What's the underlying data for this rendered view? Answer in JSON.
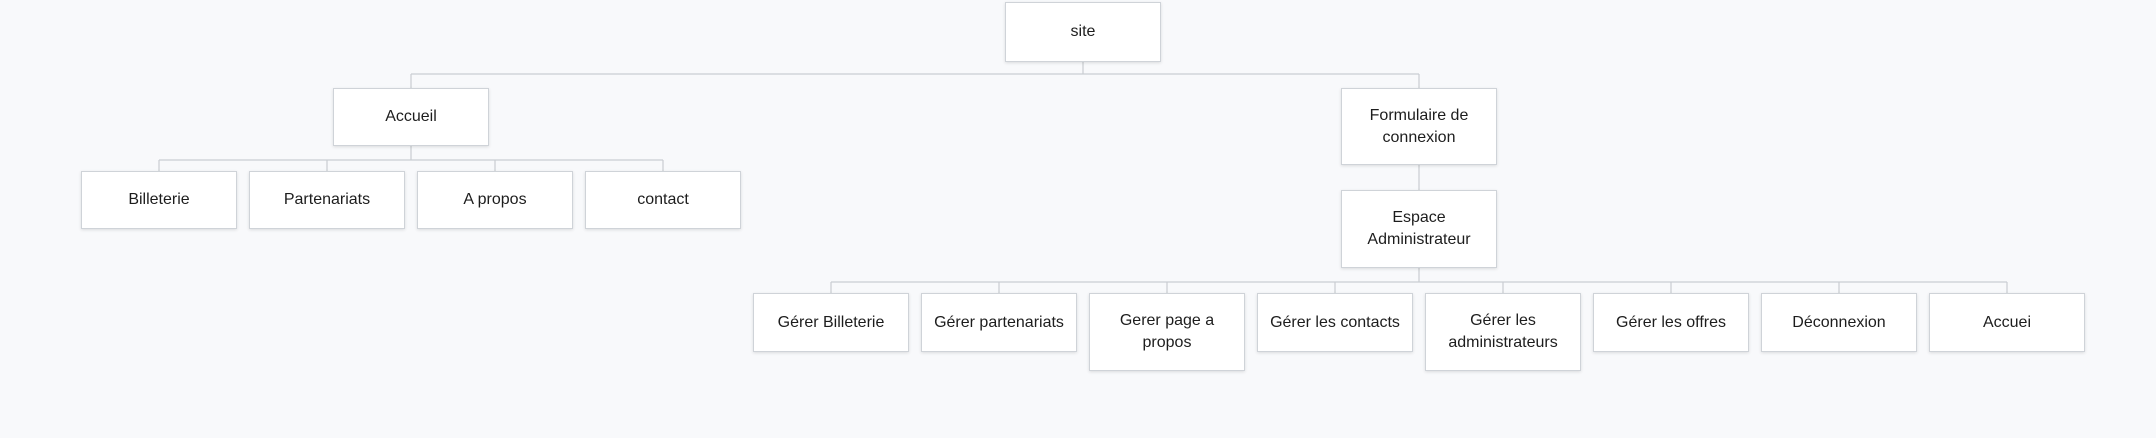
{
  "diagram": {
    "root": "site",
    "accueil_branch": {
      "label": "Accueil",
      "children": [
        "Billeterie",
        "Partenariats",
        "A propos",
        "contact"
      ]
    },
    "login_branch": {
      "label": "Formulaire de connexion",
      "admin": {
        "label": "Espace Administrateur",
        "children": [
          "Gérer Billeterie",
          "Gérer partenariats",
          "Gerer page a propos",
          "Gérer les contacts",
          "Gérer les administrateurs",
          "Gérer les offres",
          "Déconnexion",
          "Accuei"
        ]
      }
    }
  },
  "colors": {
    "connector": "#c9cdd2",
    "node_border": "#cfd3d8",
    "background": "#f8f9fb"
  }
}
